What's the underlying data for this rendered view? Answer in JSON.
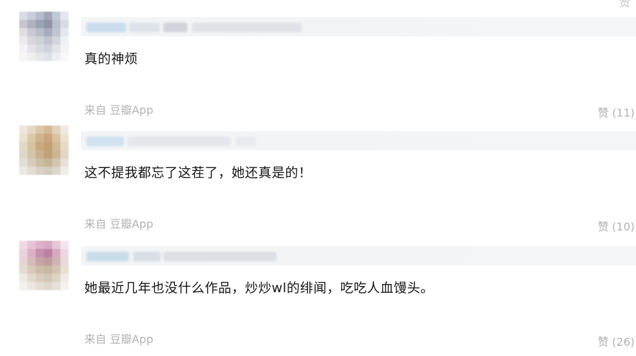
{
  "top_glyph": "赞",
  "comments": [
    {
      "text": "真的神烦",
      "source": "来自 豆瓣App",
      "likes": "赞 (11)",
      "avatar_colors": [
        "#d7dbe4",
        "#c9cdd9",
        "#b6bccc",
        "#9ea6b8",
        "#c2c8d5",
        "#e4e6ec",
        "#c8c4cf",
        "#aeb2c0",
        "#9aa2b4",
        "#8d94a8",
        "#b9bfcc",
        "#d8dbe2",
        "#e0dde3",
        "#c7c9d4",
        "#b8bdca",
        "#a5acbd",
        "#c0c5d2",
        "#e5e7ec",
        "#eceaed",
        "#d7d7dd",
        "#cfd1d9",
        "#c1c4cf",
        "#d2d5dc",
        "#eef0f2",
        "#f4f1f2",
        "#e4e3e7",
        "#d9dae0",
        "#cfd2da",
        "#e1e3e8",
        "#f3f4f6",
        "#f7f5f5",
        "#eeeeef",
        "#e6e7eb",
        "#dfe1e7",
        "#eceef1",
        "#f8f8f9"
      ]
    },
    {
      "text": "这不提我都忘了这茬了，她还真是的！",
      "source": "来自 豆瓣App",
      "likes": "赞 (10)",
      "avatar_colors": [
        "#ede7dd",
        "#e6d8c4",
        "#dcc6a7",
        "#d5b896",
        "#e2d2bb",
        "#efe9e0",
        "#e9e2d4",
        "#dbc8a9",
        "#cfb38c",
        "#c9a57d",
        "#d8c0a0",
        "#ebe2d4",
        "#e2d8c8",
        "#d7c29f",
        "#c9a87c",
        "#c29f74",
        "#d1b995",
        "#e6dbc9",
        "#ded6cb",
        "#d4c4aa",
        "#c9b18d",
        "#bfa17a",
        "#cbb593",
        "#e0d6c6",
        "#e2ddd6",
        "#d8cdbc",
        "#cdbda3",
        "#c7b494",
        "#d2c4ae",
        "#e6e0d7",
        "#ece9e5",
        "#e2ddd6",
        "#d9d2c8",
        "#d4ccc0",
        "#dcd6cd",
        "#efece8"
      ]
    },
    {
      "text": "她最近几年也没什么作品，炒炒wl的绯闻，吃吃人血馒头。",
      "source": "来自 豆瓣App",
      "likes": "赞 (26)",
      "avatar_colors": [
        "#efd9e4",
        "#e7c3d5",
        "#dcb2c9",
        "#d7a9c2",
        "#e5c7d7",
        "#f3e5ec",
        "#e9d2dd",
        "#dbb0c5",
        "#c68fae",
        "#bb80a2",
        "#d6a8bf",
        "#ecd8e2",
        "#e6d3d6",
        "#d6b8bd",
        "#c7a2a6",
        "#c09ba0",
        "#d1b2b6",
        "#e8dadc",
        "#e4dcd2",
        "#d7cabb",
        "#cdbca9",
        "#c8b6a2",
        "#d3c3b1",
        "#e7ded4",
        "#eee9e2",
        "#e2d9cd",
        "#d8ccbd",
        "#d4c6b5",
        "#ddd2c4",
        "#efeae3",
        "#f4f1ec",
        "#ebe6df",
        "#e3ddd4",
        "#ded6cc",
        "#e6e0d8",
        "#f5f2ee"
      ]
    }
  ]
}
